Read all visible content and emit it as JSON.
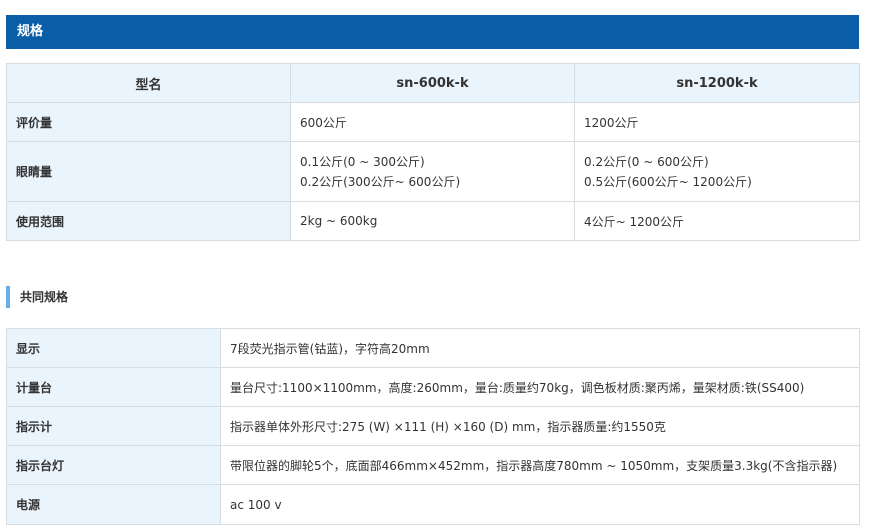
{
  "header": {
    "title": "规格"
  },
  "spec_table": {
    "columns": [
      "型名",
      "sn-600k-k",
      "sn-1200k-k"
    ],
    "rows": [
      {
        "label": "评价量",
        "col1": [
          "600公斤"
        ],
        "col2": [
          "1200公斤"
        ]
      },
      {
        "label": "眼睛量",
        "col1": [
          "0.1公斤(0 ~ 300公斤)",
          "0.2公斤(300公斤~ 600公斤)"
        ],
        "col2": [
          "0.2公斤(0 ~ 600公斤)",
          "0.5公斤(600公斤~ 1200公斤)"
        ]
      },
      {
        "label": "使用范围",
        "col1": [
          "2kg ~ 600kg"
        ],
        "col2": [
          "4公斤~ 1200公斤"
        ]
      }
    ]
  },
  "common_section": {
    "title": "共同规格"
  },
  "common_table": {
    "rows": [
      {
        "label": "显示",
        "value": "7段荧光指示管(钴蓝)，字符高20mm"
      },
      {
        "label": "计量台",
        "value": "量台尺寸:1100×1100mm，高度:260mm，量台:质量约70kg，调色板材质:聚丙烯，量架材质:铁(SS400)"
      },
      {
        "label": "指示计",
        "value": "指示器单体外形尺寸:275 (W) ×111 (H) ×160 (D) mm，指示器质量:约1550克"
      },
      {
        "label": "指示台灯",
        "value": "带限位器的脚轮5个，底面部466mm×452mm，指示器高度780mm ~ 1050mm，支架质量3.3kg(不含指示器)"
      },
      {
        "label": "电源",
        "value": "ac 100 v"
      }
    ]
  }
}
